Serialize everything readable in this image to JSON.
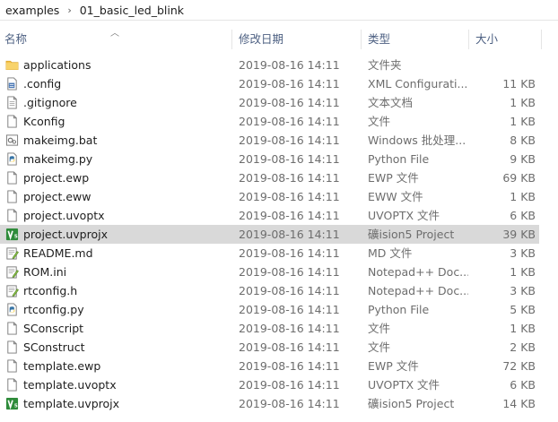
{
  "breadcrumb": {
    "items": [
      "examples",
      "01_basic_led_blink"
    ],
    "separator": "›"
  },
  "columns": {
    "name": "名称",
    "date": "修改日期",
    "type": "类型",
    "size": "大小"
  },
  "files": [
    {
      "name": "applications",
      "date": "2019-08-16 14:11",
      "type": "文件夹",
      "size": "",
      "icon": "folder-icon"
    },
    {
      "name": ".config",
      "date": "2019-08-16 14:11",
      "type": "XML Configurati...",
      "size": "11 KB",
      "icon": "config-file-icon"
    },
    {
      "name": ".gitignore",
      "date": "2019-08-16 14:11",
      "type": "文本文档",
      "size": "1 KB",
      "icon": "text-file-icon"
    },
    {
      "name": "Kconfig",
      "date": "2019-08-16 14:11",
      "type": "文件",
      "size": "1 KB",
      "icon": "blank-file-icon"
    },
    {
      "name": "makeimg.bat",
      "date": "2019-08-16 14:11",
      "type": "Windows 批处理...",
      "size": "8 KB",
      "icon": "batch-file-icon"
    },
    {
      "name": "makeimg.py",
      "date": "2019-08-16 14:11",
      "type": "Python File",
      "size": "9 KB",
      "icon": "python-file-icon"
    },
    {
      "name": "project.ewp",
      "date": "2019-08-16 14:11",
      "type": "EWP 文件",
      "size": "69 KB",
      "icon": "blank-file-icon"
    },
    {
      "name": "project.eww",
      "date": "2019-08-16 14:11",
      "type": "EWW 文件",
      "size": "1 KB",
      "icon": "blank-file-icon"
    },
    {
      "name": "project.uvoptx",
      "date": "2019-08-16 14:11",
      "type": "UVOPTX 文件",
      "size": "6 KB",
      "icon": "blank-file-icon"
    },
    {
      "name": "project.uvprojx",
      "date": "2019-08-16 14:11",
      "type": "礦ision5 Project",
      "size": "39 KB",
      "icon": "keil-project-icon",
      "selected": true
    },
    {
      "name": "README.md",
      "date": "2019-08-16 14:11",
      "type": "MD 文件",
      "size": "3 KB",
      "icon": "notepad-file-icon"
    },
    {
      "name": "ROM.ini",
      "date": "2019-08-16 14:11",
      "type": "Notepad++ Doc...",
      "size": "1 KB",
      "icon": "notepad-file-icon"
    },
    {
      "name": "rtconfig.h",
      "date": "2019-08-16 14:11",
      "type": "Notepad++ Doc...",
      "size": "3 KB",
      "icon": "notepad-file-icon"
    },
    {
      "name": "rtconfig.py",
      "date": "2019-08-16 14:11",
      "type": "Python File",
      "size": "5 KB",
      "icon": "python-file-icon"
    },
    {
      "name": "SConscript",
      "date": "2019-08-16 14:11",
      "type": "文件",
      "size": "1 KB",
      "icon": "blank-file-icon"
    },
    {
      "name": "SConstruct",
      "date": "2019-08-16 14:11",
      "type": "文件",
      "size": "2 KB",
      "icon": "blank-file-icon"
    },
    {
      "name": "template.ewp",
      "date": "2019-08-16 14:11",
      "type": "EWP 文件",
      "size": "72 KB",
      "icon": "blank-file-icon"
    },
    {
      "name": "template.uvoptx",
      "date": "2019-08-16 14:11",
      "type": "UVOPTX 文件",
      "size": "6 KB",
      "icon": "blank-file-icon"
    },
    {
      "name": "template.uvprojx",
      "date": "2019-08-16 14:11",
      "type": "礦ision5 Project",
      "size": "14 KB",
      "icon": "keil-project-icon"
    }
  ],
  "colors": {
    "selected_row": "#d9d9d9",
    "header_text": "#4d6082",
    "folder": "#f5c24c",
    "keil": "#2e8b3a",
    "python_blue": "#3673a5",
    "python_yellow": "#f7d046"
  }
}
